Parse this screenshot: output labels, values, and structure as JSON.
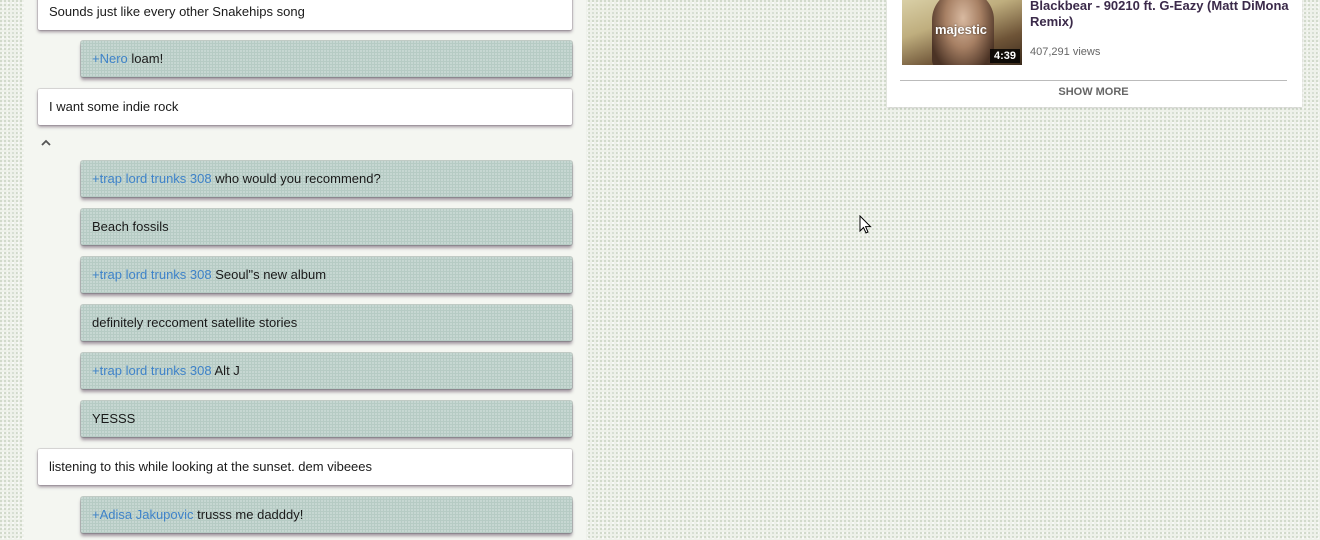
{
  "comments": [
    {
      "kind": "top",
      "text": "Sounds just like every other Snakehips song"
    },
    {
      "kind": "reply",
      "mention": "+Nero",
      "text": " loam!"
    },
    {
      "kind": "top",
      "text": "I want some indie rock"
    },
    {
      "kind": "reply",
      "mention": "+trap lord trunks 308",
      "text": " who would you recommend?"
    },
    {
      "kind": "reply",
      "mention": "",
      "text": "Beach fossils"
    },
    {
      "kind": "reply",
      "mention": "+trap lord trunks 308",
      "text": " Seoul\"s new album"
    },
    {
      "kind": "reply",
      "mention": "",
      "text": "definitely reccoment satellite stories"
    },
    {
      "kind": "reply",
      "mention": "+trap lord trunks 308",
      "text": " Alt J"
    },
    {
      "kind": "reply",
      "mention": "",
      "text": "YESSS"
    },
    {
      "kind": "top",
      "text": "listening to this while looking at the sunset. dem vibeees"
    },
    {
      "kind": "reply",
      "mention": "+Adisa Jakupovic",
      "text": " trusss me dadddy!"
    }
  ],
  "related": {
    "title": "Blackbear - 90210 ft. G-Eazy (Matt DiMona Remix)",
    "views": "407,291 views",
    "duration": "4:39",
    "thumb_text": "majestic",
    "show_more": "SHOW MORE"
  }
}
